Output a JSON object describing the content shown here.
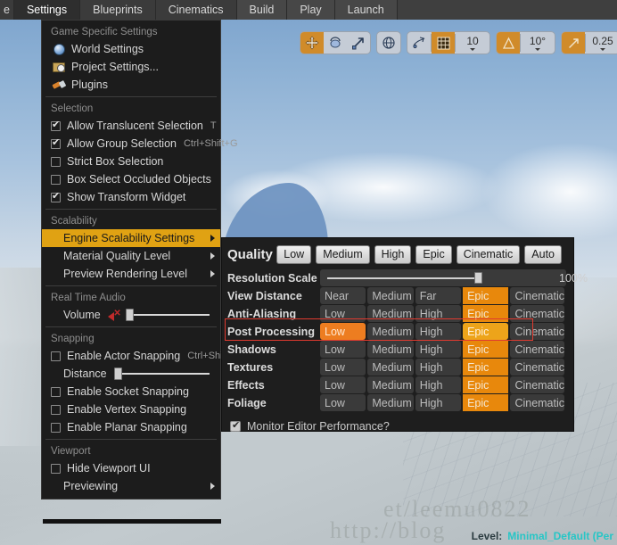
{
  "menubar": {
    "tabs": [
      {
        "label": "e",
        "state": "partial"
      },
      {
        "label": "Settings",
        "state": "active"
      },
      {
        "label": "Blueprints",
        "state": "normal"
      },
      {
        "label": "Cinematics",
        "state": "normal"
      },
      {
        "label": "Build",
        "state": "group2"
      },
      {
        "label": "Play",
        "state": "group2"
      },
      {
        "label": "Launch",
        "state": "group2"
      }
    ]
  },
  "settings_menu": {
    "sections": [
      {
        "title": "Game Specific Settings",
        "items": [
          {
            "label": "World Settings",
            "icon": "globe-icon",
            "shortcut": ""
          },
          {
            "label": "Project Settings...",
            "icon": "folder-gear-icon",
            "shortcut": ""
          },
          {
            "label": "Plugins",
            "icon": "plug-icon",
            "shortcut": ""
          }
        ]
      },
      {
        "title": "Selection",
        "items": [
          {
            "label": "Allow Translucent Selection",
            "checked": true,
            "shortcut": "T"
          },
          {
            "label": "Allow Group Selection",
            "checked": true,
            "shortcut": "Ctrl+Shift+G"
          },
          {
            "label": "Strict Box Selection",
            "checked": false,
            "shortcut": ""
          },
          {
            "label": "Box Select Occluded Objects",
            "checked": false,
            "shortcut": ""
          },
          {
            "label": "Show Transform Widget",
            "checked": true,
            "shortcut": ""
          }
        ]
      },
      {
        "title": "Scalability",
        "items": [
          {
            "label": "Engine Scalability Settings",
            "highlighted": true,
            "submenu": true
          },
          {
            "label": "Material Quality Level",
            "highlighted": false,
            "submenu": true
          },
          {
            "label": "Preview Rendering Level",
            "highlighted": false,
            "submenu": true
          }
        ]
      },
      {
        "title": "Real Time Audio",
        "items": [
          {
            "label": "Volume",
            "icon": "mute-speaker-icon",
            "slider_percent": 2
          }
        ]
      },
      {
        "title": "Snapping",
        "items": [
          {
            "label": "Enable Actor Snapping",
            "checked": false,
            "shortcut": "Ctrl+Shift+K"
          },
          {
            "label": "Distance",
            "slider_percent": 2
          },
          {
            "label": "Enable Socket Snapping",
            "checked": false,
            "shortcut": ""
          },
          {
            "label": "Enable Vertex Snapping",
            "checked": false,
            "shortcut": ""
          },
          {
            "label": "Enable Planar Snapping",
            "checked": false,
            "shortcut": ""
          }
        ]
      },
      {
        "title": "Viewport",
        "items": [
          {
            "label": "Hide Viewport UI",
            "checked": false,
            "shortcut": ""
          },
          {
            "label": "Previewing",
            "submenu": true
          }
        ]
      }
    ]
  },
  "viewport_toolbar": {
    "transform": [
      {
        "icon": "move-tool-icon",
        "active": true
      },
      {
        "icon": "rotate-tool-icon",
        "active": false
      },
      {
        "icon": "scale-tool-icon",
        "active": false
      }
    ],
    "coordinate": {
      "icon": "world-coordinate-icon",
      "active": false
    },
    "surface_snap": {
      "icon": "surface-snap-icon",
      "active": false
    },
    "grid_snap": {
      "icon": "grid-snap-icon",
      "active": true,
      "value": "10"
    },
    "angle_snap": {
      "icon": "angle-snap-icon",
      "active": true,
      "value": "10°"
    },
    "scale_snap": {
      "icon": "scale-snap-icon",
      "active": true,
      "value": "0.25"
    },
    "camera_speed": {
      "icon": "camera-speed-icon",
      "active": false
    }
  },
  "quality_panel": {
    "title": "Quality",
    "presets": [
      "Low",
      "Medium",
      "High",
      "Epic",
      "Cinematic",
      "Auto"
    ],
    "resolution_scale": {
      "label": "Resolution Scale",
      "value": "100%",
      "percent": 100
    },
    "rows": [
      {
        "label": "View Distance",
        "options": [
          "Near",
          "Medium",
          "Far",
          "Epic",
          "Cinematic"
        ],
        "selected": 3,
        "hover": -1
      },
      {
        "label": "Anti-Aliasing",
        "options": [
          "Low",
          "Medium",
          "High",
          "Epic",
          "Cinematic"
        ],
        "selected": 3,
        "hover": -1
      },
      {
        "label": "Post Processing",
        "options": [
          "Low",
          "Medium",
          "High",
          "Epic",
          "Cinematic"
        ],
        "selected": 3,
        "hover": 0,
        "outlined": true
      },
      {
        "label": "Shadows",
        "options": [
          "Low",
          "Medium",
          "High",
          "Epic",
          "Cinematic"
        ],
        "selected": 3,
        "hover": -1
      },
      {
        "label": "Textures",
        "options": [
          "Low",
          "Medium",
          "High",
          "Epic",
          "Cinematic"
        ],
        "selected": 3,
        "hover": -1
      },
      {
        "label": "Effects",
        "options": [
          "Low",
          "Medium",
          "High",
          "Epic",
          "Cinematic"
        ],
        "selected": 3,
        "hover": -1
      },
      {
        "label": "Foliage",
        "options": [
          "Low",
          "Medium",
          "High",
          "Epic",
          "Cinematic"
        ],
        "selected": 3,
        "hover": -1
      }
    ],
    "monitor_performance": {
      "label": "Monitor Editor Performance?",
      "checked": true
    }
  },
  "status_bar": {
    "level_label": "Level:",
    "level_value": "Minimal_Default (Per"
  },
  "watermarks": [
    "http://blog",
    "et/leemu0822"
  ],
  "colors": {
    "highlight_amber": "#e0a213",
    "selected_orange": "#e8880c",
    "hover_orange": "#ed7d20",
    "outline_red": "#e03a2f",
    "status_cyan": "#27c6c6",
    "menu_bg": "#1c1c1c",
    "panel_bg": "#1e1e1e"
  }
}
